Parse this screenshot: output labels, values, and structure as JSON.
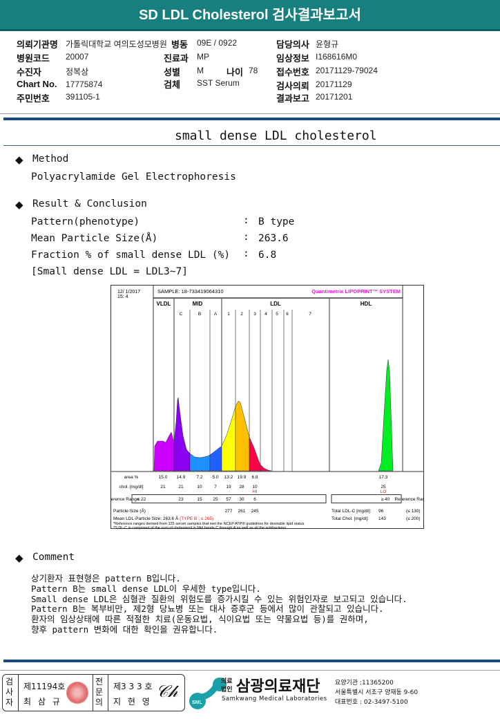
{
  "header": {
    "title": "SD LDL Cholesterol 검사결과보고서"
  },
  "info": {
    "institution_label": "의뢰기관명",
    "institution": "가톨릭대학교 여의도성모병원",
    "ward": "병동",
    "ward_value": "09E / 0922",
    "doctor_label": "담당의사",
    "doctor": "윤형규",
    "hospital_code_label": "병원코드",
    "hospital_code": "20007",
    "dept_label": "진료과",
    "dept": "MP",
    "clinical_label": "임상정보",
    "clinical": "I168616M0",
    "patient_label": "수진자",
    "patient": "정복상",
    "sex_label": "성별",
    "sex": "M",
    "age_label": "나이",
    "age": "78",
    "receipt_label": "접수번호",
    "receipt": "20171129-79024",
    "chart_label": "Chart No.",
    "chart_no": "17775874",
    "specimen_label": "검체",
    "specimen": "SST Serum",
    "request_label": "검사의뢰",
    "request": "20171129",
    "id_label": "주민번호",
    "id": "391105-1",
    "report_label": "결과보고",
    "report": "20171201"
  },
  "report": {
    "title": "small dense LDL cholesterol",
    "method_heading": "Method",
    "method": "Polyacrylamide Gel Electrophoresis",
    "result_heading": "Result & Conclusion",
    "rows": [
      {
        "label": "Pattern(phenotype)",
        "sep": ":",
        "value": "B type"
      },
      {
        "label": "Mean Particle Size(Å)",
        "sep": ":",
        "value": "263.6"
      },
      {
        "label": "Fraction % of small dense LDL (%)",
        "sep": ":",
        "value": "6.8"
      }
    ],
    "note": "[Small dense LDL = LDL3~7]",
    "comment_heading": "Comment",
    "comment": [
      "상기환자 표현형은 pattern B입니다.",
      "Pattern B는 small dense LDL이 우세한 type입니다.",
      "Small dense LDL은 심혈관 질환의 위험도를 증가시킬 수 있는 위험인자로 보고되고 있습니다.",
      "Pattern B는 복부비만, 제2형 당뇨병 또는 대사 증후군 등에서 많이 관찰되고 있습니다.",
      "환자의 임상상태에 따른 적절한 치료(운동요법, 식이요법 또는 약물요법 등)를 권하며,",
      "향후 pattern 변화에 대한 확인을 권유합니다."
    ]
  },
  "chart_data": {
    "type": "area",
    "datetime": [
      "12/ 1/2017",
      "15: 4"
    ],
    "sample": "SAMPLE:   18-733419064310",
    "system": "Quantimetrix LIPOPRINT™ SYSTEM",
    "groups": [
      "VLDL",
      "MID",
      "LDL",
      "HDL"
    ],
    "bands": [
      "C",
      "B",
      "A",
      "1",
      "2",
      "3",
      "4",
      "5",
      "6",
      "7"
    ],
    "colors": {
      "VLDL": "#cc00ff",
      "C": "#8a00f0",
      "B": "#1e90ff",
      "A": "#2060ff",
      "1": "#ffff00",
      "2": "#ffc000",
      "3": "#ff0048",
      "HDL": "#00ee22"
    },
    "area_label": "area %",
    "area": [
      "15.0",
      "14.9",
      "7.2",
      "5.0",
      "13.2",
      "19.9",
      "6.8"
    ],
    "area_hdl": "17.3",
    "chol_label": "chol. [mg/dl]",
    "chol": [
      "21",
      "21",
      "10",
      "7",
      "19",
      "28",
      "10"
    ],
    "chol_flag": "HI",
    "chol_hdl": "25",
    "chol_hdl_flag": "LO",
    "ref_label": "Reference Range",
    "ref": [
      "≤ 22",
      "23",
      "15",
      "25",
      "57",
      "30",
      "6"
    ],
    "ref_hdl": "≥ 40",
    "size_label": "Particle-Size (Å)",
    "sizes": [
      "277",
      "261",
      "245"
    ],
    "mean_label": "Mean LDL-Particle Size:   263.6 Å",
    "mean_type": "(TYPE B ; ≤ 265)",
    "total_ldl_label": "Total LDL-C [mg/dl]:",
    "total_ldl": "96",
    "total_ldl_ref": "(≤ 130)",
    "total_chol_label": "Total Chol. [mg/dl]:",
    "total_chol": "143",
    "total_chol_ref": "(≤ 200)",
    "footnotes": [
      "*Reference ranges derived from 125 serum samples that met the NCEP ATPIII guidelines for desirable lipid status",
      "**LDL-C is comprised of the sum of cholesterol in Mid bands C through A as well as all the subfractions"
    ]
  },
  "footer": {
    "examiner_label": "검사자",
    "examiner_no": "제11194호",
    "examiner": "최 삼 규",
    "specialist_label": "전문의",
    "specialist_no": "제3 3 3 호",
    "specialist": "지 현 영",
    "org_type": "의료법인",
    "org": "삼광의료재단",
    "org_en": "Samkwang Medical Laboratories",
    "logo": "SML",
    "code": "요양기관 :11365200",
    "address": "서울특별시 서초구 양재동 9-60",
    "phone": "대표번호 : 02-3497-5100"
  }
}
